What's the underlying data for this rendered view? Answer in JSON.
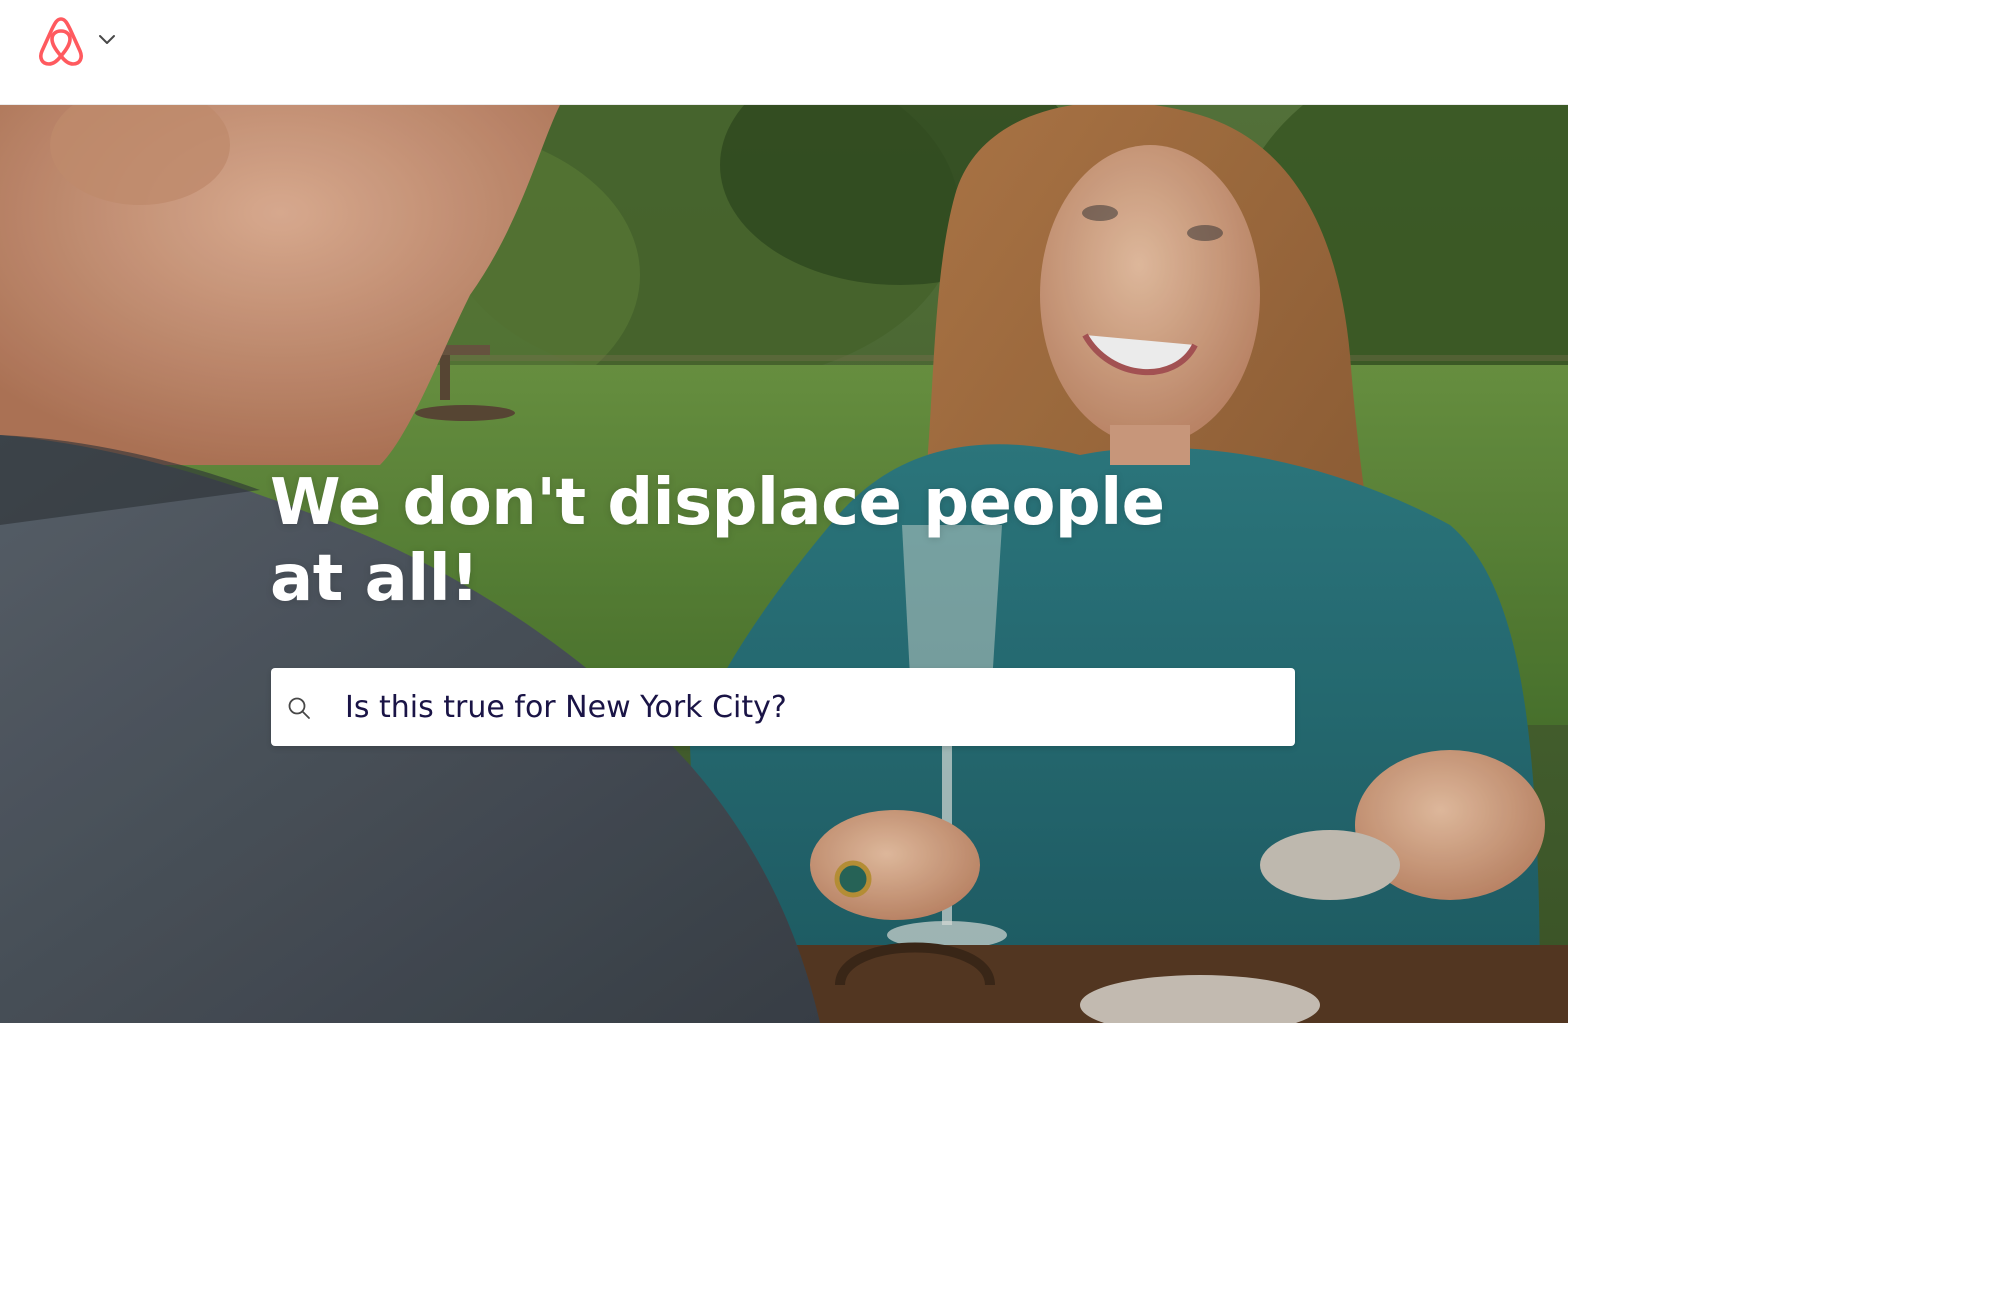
{
  "header": {
    "logo_icon": "airbnb-belo-logo-icon",
    "menu_icon": "chevron-down-icon",
    "brand_color": "#FF5A5F"
  },
  "hero": {
    "headline": "We don't displace people at all!",
    "background": "outdoor-dining-photo"
  },
  "search": {
    "icon": "search-icon",
    "value": "Is this true for New York City?",
    "text_color": "#1A1446"
  }
}
